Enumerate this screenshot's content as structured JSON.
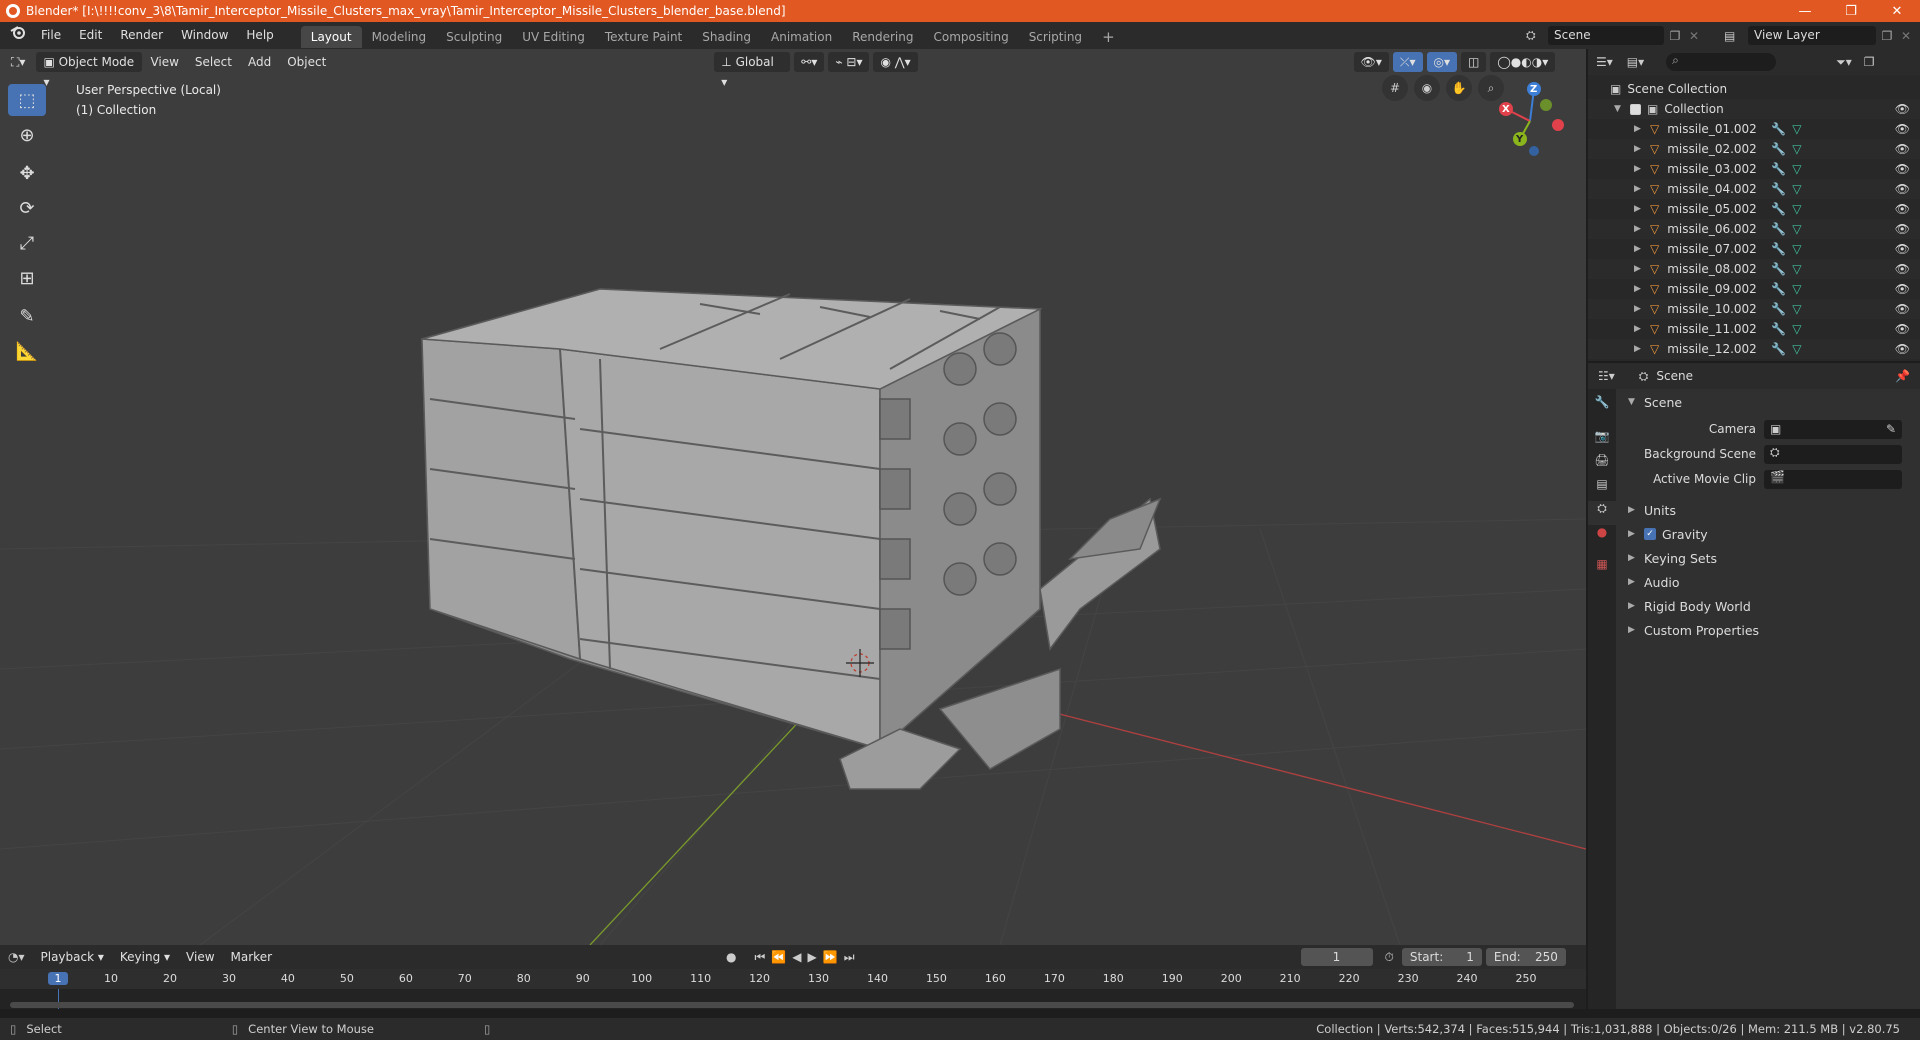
{
  "window": {
    "title": "Blender* [I:\\!!!!conv_3\\8\\Tamir_Interceptor_Missile_Clusters_max_vray\\Tamir_Interceptor_Missile_Clusters_blender_base.blend]",
    "minimize": "—",
    "restore": "❐",
    "close": "✕"
  },
  "menu": [
    "File",
    "Edit",
    "Render",
    "Window",
    "Help"
  ],
  "workspaces": [
    "Layout",
    "Modeling",
    "Sculpting",
    "UV Editing",
    "Texture Paint",
    "Shading",
    "Animation",
    "Rendering",
    "Compositing",
    "Scripting"
  ],
  "active_workspace": "Layout",
  "add_workspace": "+",
  "scene_selector": "Scene",
  "view_layer_selector": "View Layer",
  "viewport": {
    "mode": "Object Mode",
    "menus": [
      "View",
      "Select",
      "Add",
      "Object"
    ],
    "orientation": "Global",
    "perspective_label": "User Perspective (Local)",
    "collection_label": "(1) Collection",
    "gizmo_axes": {
      "x": "X",
      "y": "Y",
      "z": "Z"
    }
  },
  "tools": [
    "select-box",
    "cursor",
    "move",
    "rotate",
    "scale",
    "transform",
    "annotate",
    "measure"
  ],
  "outliner": {
    "search_placeholder": "",
    "scene_collection": "Scene Collection",
    "collection": "Collection",
    "objects": [
      "missile_01.002",
      "missile_02.002",
      "missile_03.002",
      "missile_04.002",
      "missile_05.002",
      "missile_06.002",
      "missile_07.002",
      "missile_08.002",
      "missile_09.002",
      "missile_10.002",
      "missile_11.002",
      "missile_12.002"
    ]
  },
  "properties": {
    "header": "Scene",
    "panel_title": "Scene",
    "fields": [
      {
        "label": "Camera",
        "value": ""
      },
      {
        "label": "Background Scene",
        "value": ""
      },
      {
        "label": "Active Movie Clip",
        "value": ""
      }
    ],
    "subpanels": [
      "Units",
      "Gravity",
      "Keying Sets",
      "Audio",
      "Rigid Body World",
      "Custom Properties"
    ],
    "gravity_checked": true
  },
  "timeline": {
    "menus": [
      "Playback",
      "Keying",
      "View",
      "Marker"
    ],
    "current_frame": "1",
    "start_label": "Start:",
    "start": "1",
    "end_label": "End:",
    "end": "250",
    "ticks": [
      "1",
      "10",
      "20",
      "30",
      "40",
      "50",
      "60",
      "70",
      "80",
      "90",
      "100",
      "110",
      "120",
      "130",
      "140",
      "150",
      "160",
      "170",
      "180",
      "190",
      "200",
      "210",
      "220",
      "230",
      "240",
      "250"
    ]
  },
  "status": {
    "select": "Select",
    "center_view": "Center View to Mouse",
    "stats": "Collection | Verts:542,374 | Faces:515,944 | Tris:1,031,888 | Objects:0/26 | Mem: 211.5 MB | v2.80.75"
  },
  "colors": {
    "titlebar": "#e25822",
    "accent": "#4772b3",
    "axis_x": "#e0414b",
    "axis_y": "#8bb51d",
    "axis_z": "#3d7fd6",
    "object_icon": "#e8923a",
    "modifier_icon": "#5aa0e8",
    "mesh_icon": "#40c0a0"
  }
}
